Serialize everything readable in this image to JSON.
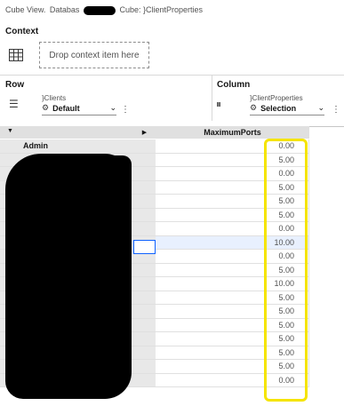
{
  "breadcrumb": {
    "cube_view": "Cube View.",
    "database": "Databas",
    "cube": "Cube: }ClientProperties"
  },
  "context": {
    "title": "Context",
    "drop_placeholder": "Drop context item here"
  },
  "row_section": {
    "title": "Row",
    "dimension": "}Clients",
    "subset": "Default"
  },
  "column_section": {
    "title": "Column",
    "dimension": "}ClientProperties",
    "subset": "Selection"
  },
  "grid": {
    "column_header": "MaximumPorts",
    "first_row_label": "Admin",
    "values": [
      "0.00",
      "5.00",
      "0.00",
      "5.00",
      "5.00",
      "5.00",
      "0.00",
      "10.00",
      "0.00",
      "5.00",
      "10.00",
      "5.00",
      "5.00",
      "5.00",
      "5.00",
      "5.00",
      "5.00",
      "0.00"
    ]
  },
  "colors": {
    "highlight": "#f5e400",
    "selection_border": "#0f62fe"
  }
}
